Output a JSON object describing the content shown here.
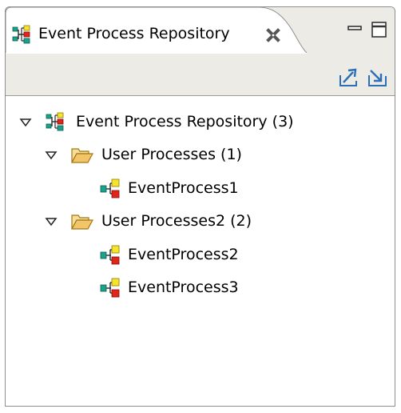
{
  "view": {
    "tab_title": "Event Process Repository",
    "tab_close_icon": "close-icon",
    "minimize_icon": "minimize-icon",
    "maximize_icon": "maximize-icon"
  },
  "toolbar": {
    "buttons": [
      {
        "icon": "export-icon"
      },
      {
        "icon": "import-icon"
      }
    ]
  },
  "tree": {
    "root": {
      "label": "Event Process Repository (3)",
      "expanded": true,
      "icon": "repository-icon"
    },
    "folders": [
      {
        "label": "User Processes (1)",
        "expanded": true,
        "icon": "folder-open-icon",
        "children": [
          {
            "label": "EventProcess1",
            "icon": "event-process-icon"
          }
        ]
      },
      {
        "label": "User Processes2 (2)",
        "expanded": true,
        "icon": "folder-open-icon",
        "children": [
          {
            "label": "EventProcess2",
            "icon": "event-process-icon"
          },
          {
            "label": "EventProcess3",
            "icon": "event-process-icon"
          }
        ]
      }
    ]
  },
  "colors": {
    "toolbar_bg": "#ecebe6",
    "view_border": "#8e8e8e",
    "folder": "#f2c56b",
    "process_teal": "#1aa28a",
    "process_yellow": "#f7e32a",
    "process_red": "#e3241b",
    "toolbar_icon": "#2a6fb8"
  }
}
